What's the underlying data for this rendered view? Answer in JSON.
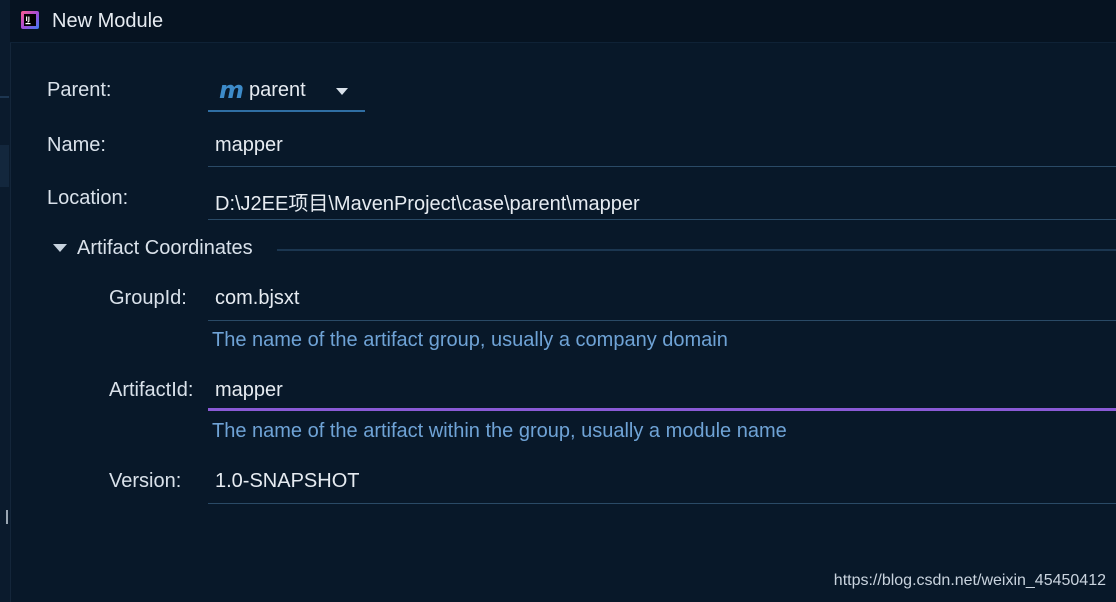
{
  "window": {
    "title": "New Module",
    "icon": "intellij-idea-icon"
  },
  "form": {
    "parent": {
      "label": "Parent:",
      "value": "parent",
      "icon": "maven-m-icon",
      "icon_glyph": "m"
    },
    "name": {
      "label": "Name:",
      "value": "mapper"
    },
    "location": {
      "label": "Location:",
      "value": "D:\\J2EE项目\\MavenProject\\case\\parent\\mapper"
    }
  },
  "artifact_section": {
    "title": "Artifact Coordinates",
    "expanded": true,
    "group_id": {
      "label": "GroupId:",
      "value": "com.bjsxt",
      "hint": "The name of the artifact group, usually a company domain"
    },
    "artifact_id": {
      "label": "ArtifactId:",
      "value": "mapper",
      "hint": "The name of the artifact within the group, usually a module name",
      "focused": true
    },
    "version": {
      "label": "Version:",
      "value": "1.0-SNAPSHOT"
    }
  },
  "watermark": "https://blog.csdn.net/weixin_45450412",
  "colors": {
    "background": "#081829",
    "hint_text": "#6fa3d6",
    "focus_underline": "#8a5ad6",
    "combo_underline": "#2f6ea3",
    "maven_icon": "#3d8bc9"
  }
}
